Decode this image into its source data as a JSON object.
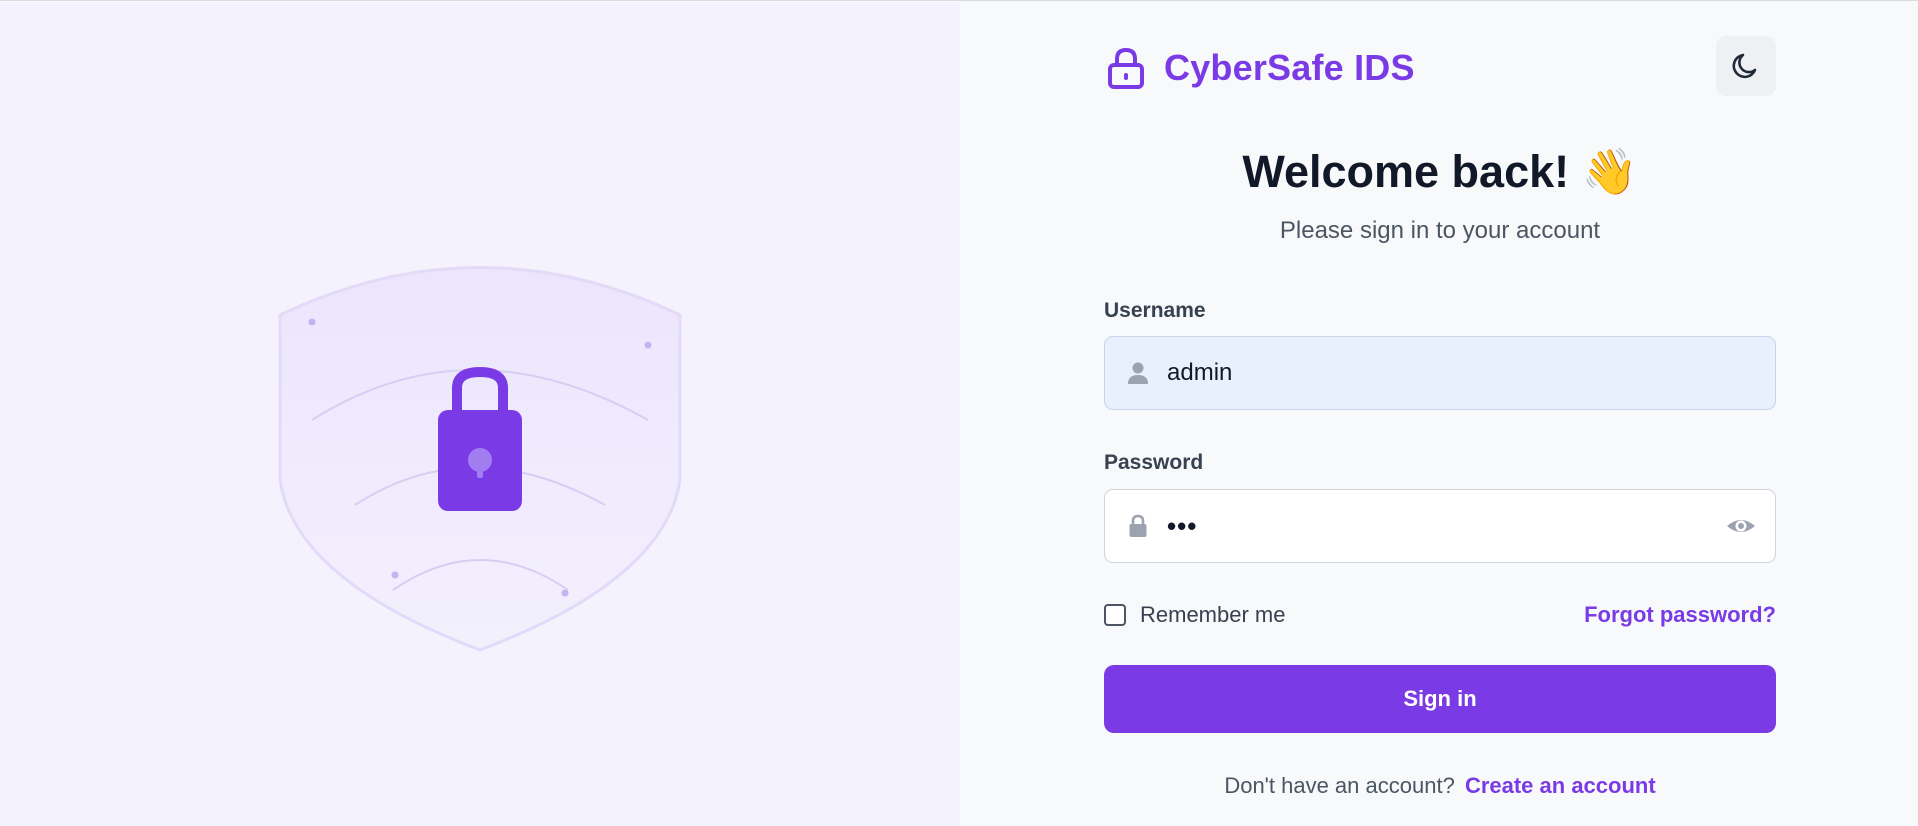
{
  "brand": {
    "name": "CyberSafe IDS",
    "icon": "lock-icon",
    "accent_color": "#7a3be6"
  },
  "theme_toggle": {
    "icon": "moon-icon"
  },
  "heading": {
    "title": "Welcome back!",
    "emoji": "👋",
    "subtitle": "Please sign in to your account"
  },
  "form": {
    "username": {
      "label": "Username",
      "value": "admin",
      "icon": "user-icon"
    },
    "password": {
      "label": "Password",
      "value": "•••",
      "icon": "lock-icon",
      "toggle_icon": "eye-icon"
    },
    "remember_label": "Remember me",
    "remember_checked": false,
    "forgot_label": "Forgot password?",
    "submit_label": "Sign in",
    "signup_prompt": "Don't have an account?",
    "signup_link": "Create an account"
  },
  "illustration": {
    "icon": "shield-lock-icon"
  }
}
